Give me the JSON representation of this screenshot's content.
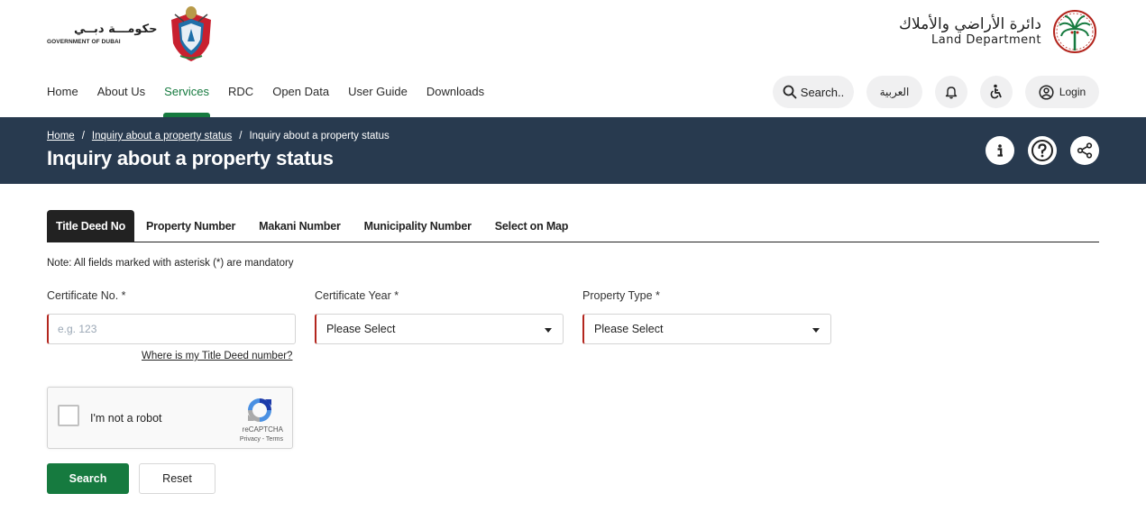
{
  "header": {
    "gov_logo_arabic": "حكومـــة دبــي",
    "gov_logo_english": "GOVERNMENT OF DUBAI",
    "dld_logo_arabic": "دائرة الأراضي والأملاك",
    "dld_logo_english": "Land Department"
  },
  "nav": {
    "items": [
      {
        "label": "Home"
      },
      {
        "label": "About Us"
      },
      {
        "label": "Services",
        "active": true
      },
      {
        "label": "RDC"
      },
      {
        "label": "Open Data"
      },
      {
        "label": "User Guide"
      },
      {
        "label": "Downloads"
      }
    ],
    "search_label": "Search..",
    "language_label": "العربية",
    "login_label": "Login",
    "icons": [
      "search-icon",
      "bell-icon",
      "accessibility-icon",
      "user-circle-icon"
    ]
  },
  "banner": {
    "breadcrumb": [
      {
        "label": "Home",
        "link": true
      },
      {
        "label": "Inquiry about a property status",
        "link": true
      },
      {
        "label": "Inquiry about a property status",
        "link": false
      }
    ],
    "separator": "/",
    "title": "Inquiry about a property status",
    "icons": [
      "info-icon",
      "help-icon",
      "share-icon"
    ]
  },
  "tabs": [
    {
      "label": "Title Deed No",
      "active": true
    },
    {
      "label": "Property Number"
    },
    {
      "label": "Makani Number"
    },
    {
      "label": "Municipality Number"
    },
    {
      "label": "Select on Map"
    }
  ],
  "form": {
    "note": "Note: All fields marked with asterisk (*) are mandatory",
    "certificate_label": "Certificate No. *",
    "certificate_placeholder": "e.g. 123",
    "certificate_value": "",
    "year_label": "Certificate Year *",
    "year_value": "Please Select",
    "type_label": "Property Type *",
    "type_value": "Please Select",
    "help_link": "Where is my Title Deed number?"
  },
  "captcha": {
    "label": "I'm not a robot",
    "brand": "reCAPTCHA",
    "terms": "Privacy - Terms",
    "checked": false
  },
  "buttons": {
    "search": "Search",
    "reset": "Reset"
  },
  "colors": {
    "accent_green": "#167a3f",
    "banner_navy": "#283a4f",
    "required_red": "#b3261e"
  }
}
